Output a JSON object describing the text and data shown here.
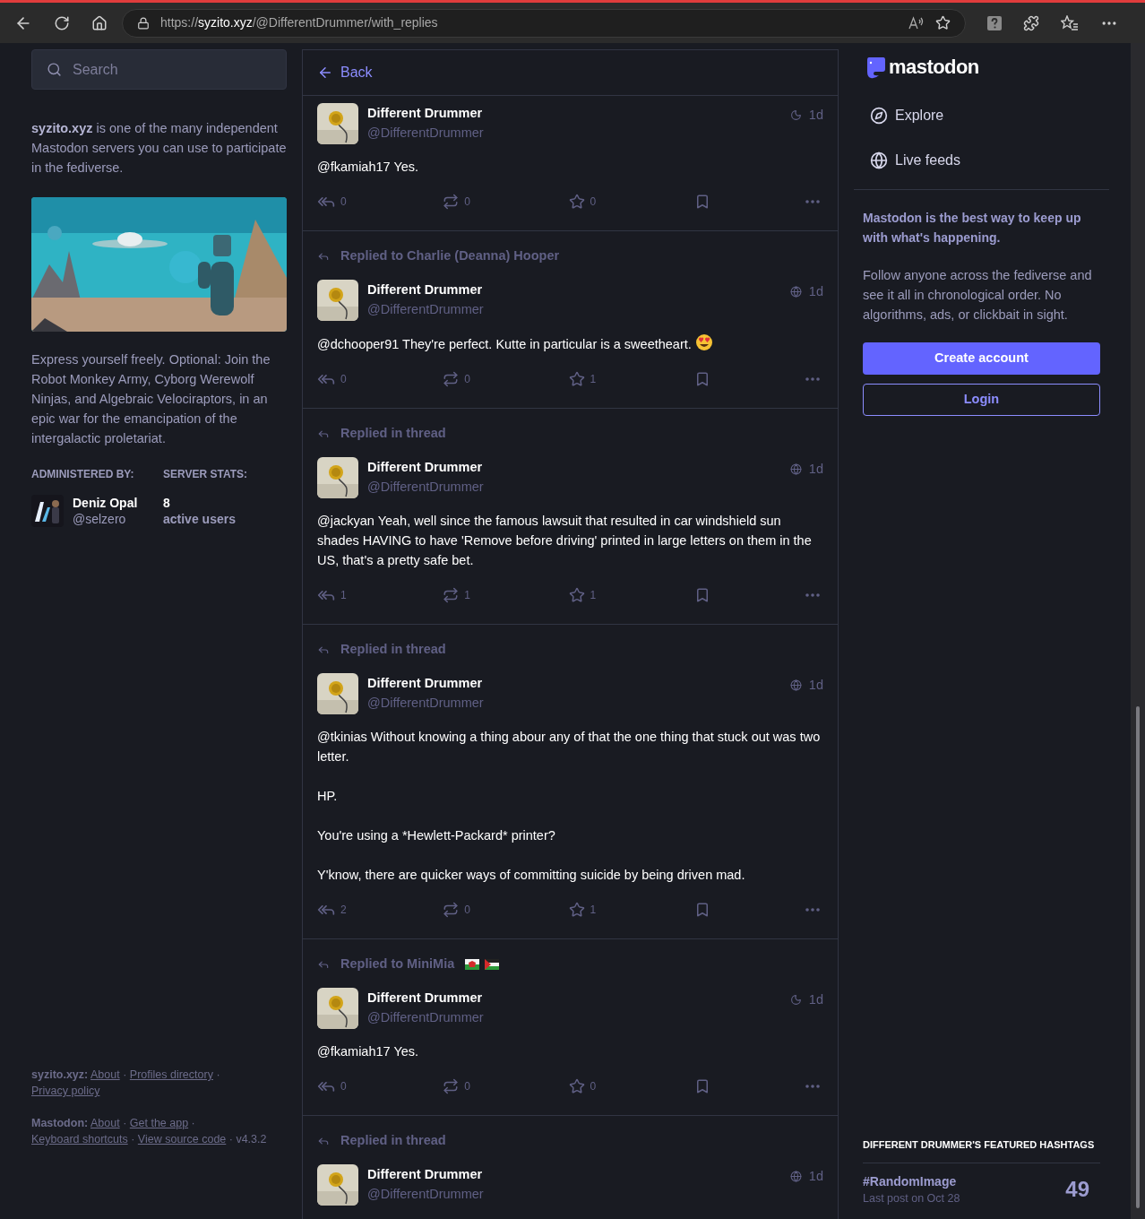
{
  "browser": {
    "url": {
      "scheme": "https://",
      "host": "syzito.xyz",
      "path": "/@DifferentDrummer/with_replies"
    }
  },
  "sidebar_left": {
    "search": {
      "placeholder": "Search"
    },
    "about": "**syzito.xyz** is one of the many independent Mastodon servers you can use to participate in the fediverse.",
    "description": "Express yourself freely. Optional: Join the Robot Monkey Army, Cyborg Werewolf Ninjas, and Algebraic Velociraptors, in an epic war for the emancipation of the intergalactic proletariat.",
    "admin": {
      "heading": "ADMINISTERED BY:",
      "name": "Deniz Opal",
      "handle": "@selzero"
    },
    "stats": {
      "heading": "SERVER STATS:",
      "count": "8",
      "label": "active users"
    },
    "footer": {
      "separator": "·",
      "sections": [
        {
          "label": "syzito.xyz:",
          "links": [
            "About",
            "Profiles directory",
            "Privacy policy"
          ]
        },
        {
          "label": "Mastodon:",
          "links": [
            "About",
            "Get the app",
            "Keyboard shortcuts",
            "View source code"
          ],
          "version": "v4.3.2"
        }
      ]
    }
  },
  "column": {
    "back": "Back",
    "posts": [
      {
        "name": "Different Drummer",
        "handle": "@DifferentDrummer",
        "kind": "unlisted",
        "time": "1d",
        "paragraphs": [
          "@fkamiah17 Yes."
        ],
        "emoji": false,
        "replies": "0",
        "boosts": "0",
        "favourites": "0"
      },
      {
        "prepend": "Replied to Charlie (Deanna) Hooper",
        "flags": false,
        "name": "Different Drummer",
        "handle": "@DifferentDrummer",
        "kind": "public",
        "time": "1d",
        "paragraphs": [
          "@dchooper91 They're perfect.  Kutte in particular is a sweetheart."
        ],
        "emoji": true,
        "replies": "0",
        "boosts": "0",
        "favourites": "1"
      },
      {
        "prepend": "Replied in thread",
        "flags": false,
        "name": "Different Drummer",
        "handle": "@DifferentDrummer",
        "kind": "public",
        "time": "1d",
        "paragraphs": [
          "@jackyan Yeah, well since the famous lawsuit that resulted in car windshield sun shades HAVING to have 'Remove before driving' printed in large letters on them in the US, that's a pretty safe bet."
        ],
        "emoji": false,
        "replies": "1",
        "boosts": "1",
        "favourites": "1"
      },
      {
        "prepend": "Replied in thread",
        "flags": false,
        "name": "Different Drummer",
        "handle": "@DifferentDrummer",
        "kind": "public",
        "time": "1d",
        "paragraphs": [
          "@tkinias Without knowing a thing abour any of that the one thing that stuck out was two letter.",
          "HP.",
          "You're using a *Hewlett-Packard* printer?",
          "Y'know, there are quicker ways of committing suicide by being driven mad."
        ],
        "emoji": false,
        "replies": "2",
        "boosts": "0",
        "favourites": "1"
      },
      {
        "prepend": "Replied to MiniMia",
        "flags": true,
        "name": "Different Drummer",
        "handle": "@DifferentDrummer",
        "kind": "unlisted",
        "time": "1d",
        "paragraphs": [
          "@fkamiah17 Yes."
        ],
        "emoji": false,
        "replies": "0",
        "boosts": "0",
        "favourites": "0"
      },
      {
        "prepend": "Replied in thread",
        "flags": false,
        "name": "Different Drummer",
        "handle": "@DifferentDrummer",
        "kind": "public",
        "time": "1d"
      }
    ]
  },
  "sidebar_right": {
    "logo": "mastodon",
    "nav": [
      {
        "label": "Explore",
        "kind": "explore"
      },
      {
        "label": "Live feeds",
        "kind": "live"
      }
    ],
    "pitch": "Mastodon is the best way to keep up with what's happening.",
    "blurb": "Follow anyone across the fediverse and see it all in chronological order. No algorithms, ads, or clickbait in sight.",
    "buttons": [
      {
        "label": "Create account",
        "kind": "primary"
      },
      {
        "label": "Login",
        "kind": "outline"
      }
    ],
    "hashtags": {
      "heading": "DIFFERENT DRUMMER'S FEATURED HASHTAGS",
      "items": [
        {
          "tag": "#RandomImage",
          "last_post": "Last post on Oct 28",
          "count": "49"
        }
      ]
    }
  }
}
